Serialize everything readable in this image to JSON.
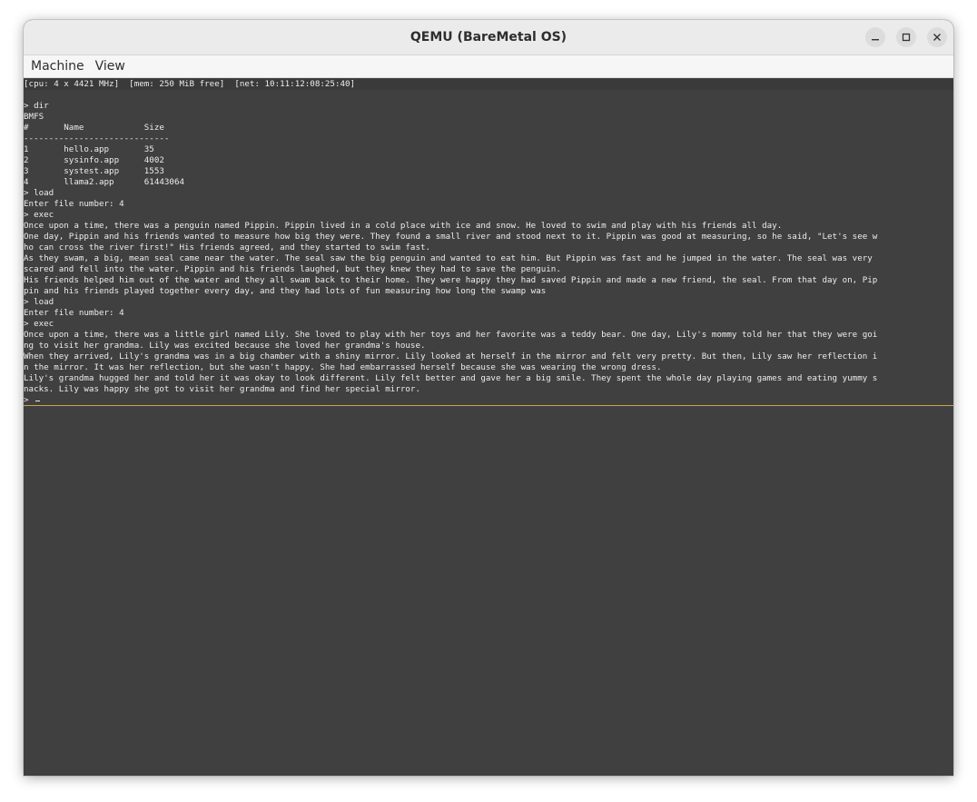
{
  "window": {
    "title": "QEMU (BareMetal OS)",
    "controls": [
      "minimize-icon",
      "maximize-icon",
      "close-icon"
    ]
  },
  "menubar": {
    "items": [
      "Machine",
      "View"
    ]
  },
  "console": {
    "lines": [
      "[cpu: 4 x 4421 MHz]  [mem: 250 MiB free]  [net: 10:11:12:08:25:40]",
      "",
      "> dir",
      "BMFS",
      "#       Name            Size",
      "-----------------------------",
      "1       hello.app       35",
      "2       sysinfo.app     4002",
      "3       systest.app     1553",
      "4       llama2.app      61443064",
      "> load",
      "Enter file number: 4",
      "> exec",
      "Once upon a time, there was a penguin named Pippin. Pippin lived in a cold place with ice and snow. He loved to swim and play with his friends all day.",
      "One day, Pippin and his friends wanted to measure how big they were. They found a small river and stood next to it. Pippin was good at measuring, so he said, \"Let's see w",
      "ho can cross the river first!\" His friends agreed, and they started to swim fast.",
      "As they swam, a big, mean seal came near the water. The seal saw the big penguin and wanted to eat him. But Pippin was fast and he jumped in the water. The seal was very",
      "scared and fell into the water. Pippin and his friends laughed, but they knew they had to save the penguin.",
      "His friends helped him out of the water and they all swam back to their home. They were happy they had saved Pippin and made a new friend, the seal. From that day on, Pip",
      "pin and his friends played together every day, and they had lots of fun measuring how long the swamp was",
      "> load",
      "Enter file number: 4",
      "> exec",
      "Once upon a time, there was a little girl named Lily. She loved to play with her toys and her favorite was a teddy bear. One day, Lily's mommy told her that they were goi",
      "ng to visit her grandma. Lily was excited because she loved her grandma's house.",
      "When they arrived, Lily's grandma was in a big chamber with a shiny mirror. Lily looked at herself in the mirror and felt very pretty. But then, Lily saw her reflection i",
      "n the mirror. It was her reflection, but she wasn't happy. She had embarrassed herself because she was wearing the wrong dress.",
      "Lily's grandma hugged her and told her it was okay to look different. Lily felt better and gave her a big smile. They spent the whole day playing games and eating yummy s",
      "nacks. Lily was happy she got to visit her grandma and find her special mirror.",
      "> "
    ]
  },
  "colors": {
    "console_bg": "#404040",
    "console_fg": "#ececec",
    "divider": "#c7a44a",
    "titlebar_bg": "#ebebeb",
    "menubar_bg": "#f6f6f6"
  }
}
